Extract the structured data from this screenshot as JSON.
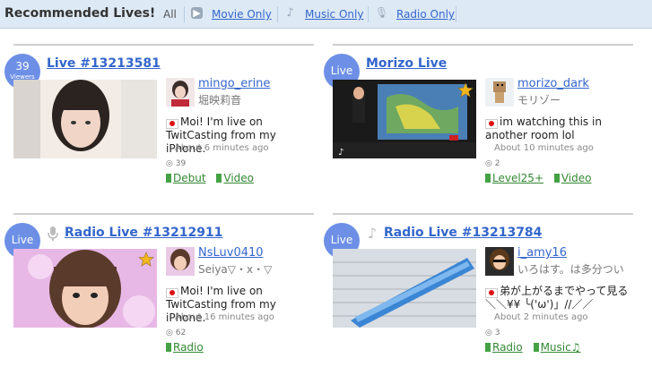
{
  "header": {
    "title": "Recommended Lives!",
    "tabs": [
      {
        "label": "All"
      },
      {
        "label": "Movie Only"
      },
      {
        "label": "Music Only"
      },
      {
        "label": "Radio Only"
      }
    ]
  },
  "cards": [
    {
      "badge_main": "39",
      "badge_sub": "Viewers",
      "title": "Live #13213581",
      "username": "mingo_erine",
      "screen_name": "堀映莉音",
      "message": "Moi! I'm live on TwitCasting from my iPhone.",
      "time": "About 6 minutes ago",
      "viewers": "39",
      "tags": [
        "Debut",
        "Video"
      ]
    },
    {
      "badge_main": "Live",
      "title": "Morizo Live",
      "username": "morizo_dark",
      "screen_name": "モリゾー",
      "message": "im watching this in another room lol",
      "time": "About 10 minutes ago",
      "viewers": "2",
      "tags": [
        "Level25+",
        "Video"
      ]
    },
    {
      "badge_main": "Live",
      "title": "Radio Live #13212911",
      "username": "NsLuv0410",
      "screen_name": "Seiya▽・x・▽",
      "message": "Moi! I'm live on TwitCasting from my iPhone.",
      "time": "About 16 minutes ago",
      "viewers": "62",
      "tags": [
        "Radio"
      ]
    },
    {
      "badge_main": "Live",
      "title": "Radio Live #13213784",
      "username": "i_amy16",
      "screen_name": "いろはす。は多分つい",
      "message": "弟が上がるまでやって見る＼＼¥¥ ╰('ω')」//／／",
      "time": "About 2 minutes ago",
      "viewers": "3",
      "tags": [
        "Radio",
        "Music♫"
      ]
    }
  ]
}
